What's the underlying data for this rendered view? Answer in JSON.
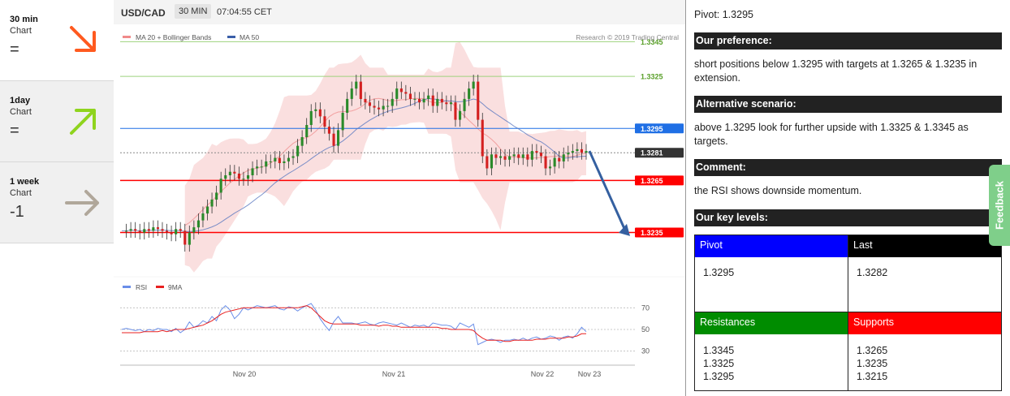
{
  "timeframes": [
    {
      "period": "30 min",
      "label": "Chart",
      "score": "=",
      "arrow": "down-right-arrow-icon",
      "color": "#ff5a1f"
    },
    {
      "period": "1day",
      "label": "Chart",
      "score": "=",
      "arrow": "up-right-arrow-icon",
      "color": "#8fd41e"
    },
    {
      "period": "1 week",
      "label": "Chart",
      "score": "-1",
      "arrow": "right-arrow-icon",
      "color": "#b0a79a"
    }
  ],
  "chart": {
    "symbol": "USD/CAD",
    "interval": "30 MIN",
    "time": "07:04:55 CET",
    "legend_bb": "MA 20 + Bollinger Bands",
    "legend_ma50": "MA 50",
    "credit": "Research © 2019 Trading Central",
    "rsi_legend": "RSI",
    "rsi_ma_legend": "9MA",
    "dates": [
      "Nov 20",
      "Nov 21",
      "Nov 22",
      "Nov 23"
    ],
    "rsi_ticks": [
      "70",
      "50",
      "30"
    ],
    "colors": {
      "up": "#2a8a2a",
      "down": "#d42020",
      "ma50": "#5a78c0",
      "band": "#f7c9c9",
      "pivot": "#1f6fe5",
      "support": "#ff0000",
      "resistance": "#8fce6a",
      "arrow": "#3560a0"
    }
  },
  "chart_data": {
    "type": "candlestick",
    "price_levels": [
      {
        "value": 1.3345,
        "label": "1.3345",
        "kind": "resistance"
      },
      {
        "value": 1.3325,
        "label": "1.3325",
        "kind": "resistance"
      },
      {
        "value": 1.3295,
        "label": "1.3295",
        "kind": "pivot"
      },
      {
        "value": 1.3281,
        "label": "1.3281",
        "kind": "last"
      },
      {
        "value": 1.3265,
        "label": "1.3265",
        "kind": "support"
      },
      {
        "value": 1.3235,
        "label": "1.3235",
        "kind": "support"
      }
    ],
    "price_path": [
      1.3236,
      1.3236,
      1.3237,
      1.3236,
      1.3235,
      1.3237,
      1.3236,
      1.3238,
      1.3237,
      1.3236,
      1.3235,
      1.3234,
      1.3237,
      1.3236,
      1.3228,
      1.3235,
      1.3238,
      1.3242,
      1.3246,
      1.325,
      1.3254,
      1.3258,
      1.3266,
      1.3268,
      1.327,
      1.3269,
      1.3266,
      1.3266,
      1.3268,
      1.3272,
      1.3273,
      1.3273,
      1.3276,
      1.3276,
      1.3278,
      1.3275,
      1.3276,
      1.3278,
      1.3279,
      1.3285,
      1.329,
      1.3297,
      1.3305,
      1.3306,
      1.3302,
      1.3296,
      1.3292,
      1.3285,
      1.3294,
      1.3304,
      1.3312,
      1.3318,
      1.3322,
      1.3312,
      1.331,
      1.3308,
      1.3307,
      1.3306,
      1.3308,
      1.3308,
      1.3312,
      1.3318,
      1.3316,
      1.3315,
      1.3312,
      1.3312,
      1.331,
      1.3312,
      1.3314,
      1.3308,
      1.3312,
      1.331,
      1.3309,
      1.331,
      1.33,
      1.3305,
      1.3312,
      1.3318,
      1.3322,
      1.33,
      1.3279,
      1.3272,
      1.328,
      1.3278,
      1.3279,
      1.3277,
      1.3279,
      1.328,
      1.3278,
      1.328,
      1.3277,
      1.3282,
      1.3281,
      1.3279,
      1.3272,
      1.3273,
      1.3278,
      1.3276,
      1.328,
      1.3281,
      1.3282,
      1.3283,
      1.3281,
      1.3282
    ],
    "rsi": [
      50,
      51,
      50,
      49,
      50,
      48,
      50,
      49,
      51,
      50,
      50,
      48,
      51,
      47,
      50,
      57,
      52,
      54,
      58,
      56,
      62,
      58,
      68,
      72,
      68,
      60,
      64,
      70,
      68,
      70,
      72,
      71,
      70,
      71,
      72,
      69,
      68,
      71,
      70,
      67,
      70,
      72,
      74,
      68,
      60,
      54,
      49,
      57,
      62,
      56,
      56,
      56,
      55,
      56,
      57,
      55,
      54,
      56,
      57,
      56,
      55,
      54,
      56,
      54,
      52,
      54,
      53,
      54,
      52,
      56,
      55,
      54,
      54,
      53,
      50,
      56,
      54,
      52,
      55,
      36,
      38,
      40,
      41,
      40,
      38,
      40,
      40,
      41,
      40,
      42,
      40,
      42,
      43,
      41,
      42,
      44,
      43,
      40,
      43,
      44,
      42,
      46,
      52,
      48
    ],
    "rsi_ma": [
      47,
      47,
      47,
      47,
      47,
      48,
      48,
      48,
      48,
      49,
      48,
      49,
      50,
      50,
      50,
      51,
      52,
      53,
      54,
      56,
      58,
      61,
      64,
      66,
      67,
      68,
      69,
      70,
      70,
      70,
      70,
      70,
      70,
      70,
      70,
      70,
      70,
      70,
      70,
      70,
      71,
      72,
      70,
      66,
      62,
      58,
      56,
      55,
      55,
      55,
      55,
      55,
      55,
      54,
      54,
      54,
      54,
      53,
      54,
      54,
      53,
      53,
      52,
      52,
      52,
      52,
      52,
      52,
      52,
      52,
      52,
      51,
      51,
      50,
      50,
      50,
      50,
      50,
      49,
      45,
      42,
      40,
      40,
      40,
      40,
      39,
      39,
      40,
      40,
      40,
      40,
      40,
      41,
      41,
      41,
      42,
      42,
      42,
      42,
      43,
      43,
      44,
      46,
      46
    ],
    "rsi_ylim": [
      20,
      80
    ],
    "ylim": [
      1.321,
      1.3355
    ],
    "x_labels": [
      "Nov 20",
      "Nov 21",
      "Nov 22",
      "Nov 23"
    ],
    "legend": [
      "MA 20 + Bollinger Bands",
      "MA 50",
      "RSI",
      "9MA"
    ]
  },
  "right": {
    "pivot_line": "Pivot: 1.3295",
    "pref_heading": "Our preference:",
    "pref_text": "short positions below 1.3295 with targets at 1.3265 & 1.3235 in extension.",
    "alt_heading": "Alternative scenario:",
    "alt_text": "above 1.3295 look for further upside with 1.3325 & 1.3345 as targets.",
    "comment_heading": "Comment:",
    "comment_text": "the RSI shows downside momentum.",
    "levels_heading": "Our key levels:",
    "table": {
      "pivot_label": "Pivot",
      "pivot_value": "1.3295",
      "last_label": "Last",
      "last_value": "1.3282",
      "res_label": "Resistances",
      "res_values": [
        "1.3345",
        "1.3325",
        "1.3295"
      ],
      "sup_label": "Supports",
      "sup_values": [
        "1.3265",
        "1.3235",
        "1.3215"
      ],
      "colors": {
        "pivot": "#0000ff",
        "last": "#000000",
        "res": "#008c00",
        "sup": "#ff0000"
      }
    }
  },
  "feedback_label": "Feedback"
}
